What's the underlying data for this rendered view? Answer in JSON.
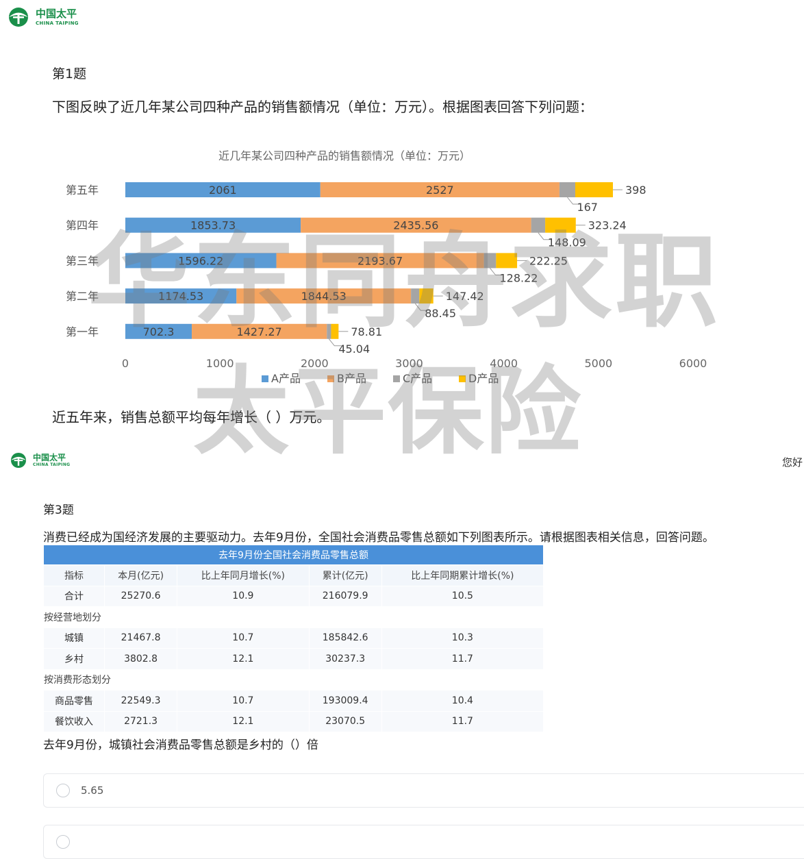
{
  "header1": {
    "logo_cn": "中国太平",
    "logo_en": "CHINA TAIPING"
  },
  "q1": {
    "title": "第1题",
    "text": "下图反映了近几年某公司四种产品的销售额情况（单位：万元）。根据图表回答下列问题：",
    "question": "近五年来，销售总额平均每年增长（ ）万元。"
  },
  "chart_data": {
    "type": "bar",
    "orientation": "horizontal",
    "stacked": true,
    "title": "近几年某公司四种产品的销售额情况（单位：万元）",
    "categories": [
      "第五年",
      "第四年",
      "第三年",
      "第二年",
      "第一年"
    ],
    "series": [
      {
        "name": "A产品",
        "color": "#5b9bd5",
        "values": [
          2061,
          1853.73,
          1596.22,
          1174.53,
          702.3
        ]
      },
      {
        "name": "B产品",
        "color": "#f4a460",
        "values": [
          2527,
          2435.56,
          2193.67,
          1844.53,
          1427.27
        ]
      },
      {
        "name": "C产品",
        "color": "#a5a5a5",
        "values": [
          167,
          148.09,
          128.22,
          88.45,
          45.04
        ]
      },
      {
        "name": "D产品",
        "color": "#ffc000",
        "values": [
          398,
          323.24,
          222.25,
          147.42,
          78.81
        ]
      }
    ],
    "value_labels": [
      [
        "2061",
        "2527",
        "167",
        "398"
      ],
      [
        "1853.73",
        "2435.56",
        "148.09",
        "323.24"
      ],
      [
        "1596.22",
        "2193.67",
        "128.22",
        "222.25"
      ],
      [
        "1174.53",
        "1844.53",
        "88.45",
        "147.42"
      ],
      [
        "702.3",
        "1427.27",
        "45.04",
        "78.81"
      ]
    ],
    "xlim": [
      0,
      6000
    ],
    "xticks": [
      "0",
      "1000",
      "2000",
      "3000",
      "4000",
      "5000",
      "6000"
    ],
    "legend": "bottom",
    "grid": false
  },
  "watermark": {
    "line1": "华东同舟求职",
    "line2": "太平保险"
  },
  "header2": {
    "logo_cn": "中国太平",
    "logo_en": "CHINA TAIPING",
    "greeting": "您好"
  },
  "q3": {
    "title": "第3题",
    "text": "消费已经成为国经济发展的主要驱动力。去年9月份，全国社会消费品零售总额如下列图表所示。请根据图表相关信息，回答问题。",
    "question": "去年9月份，城镇社会消费品零售总额是乡村的（）倍",
    "table": {
      "caption": "去年9月份全国社会消费品零售总额",
      "headers": [
        "指标",
        "本月(亿元)",
        "比上年同月增长(%)",
        "累计(亿元)",
        "比上年同期累计增长(%)"
      ],
      "rows": [
        {
          "kind": "data",
          "cells": [
            "合计",
            "25270.6",
            "10.9",
            "216079.9",
            "10.5"
          ]
        },
        {
          "kind": "section",
          "label": "按经营地划分"
        },
        {
          "kind": "data",
          "cells": [
            "城镇",
            "21467.8",
            "10.7",
            "185842.6",
            "10.3"
          ]
        },
        {
          "kind": "data",
          "cells": [
            "乡村",
            "3802.8",
            "12.1",
            "30237.3",
            "11.7"
          ]
        },
        {
          "kind": "section",
          "label": "按消费形态划分"
        },
        {
          "kind": "data",
          "cells": [
            "商品零售",
            "22549.3",
            "10.7",
            "193009.4",
            "10.4"
          ]
        },
        {
          "kind": "data",
          "cells": [
            "餐饮收入",
            "2721.3",
            "12.1",
            "23070.5",
            "11.7"
          ]
        }
      ]
    },
    "options": [
      "5.65",
      ""
    ]
  }
}
